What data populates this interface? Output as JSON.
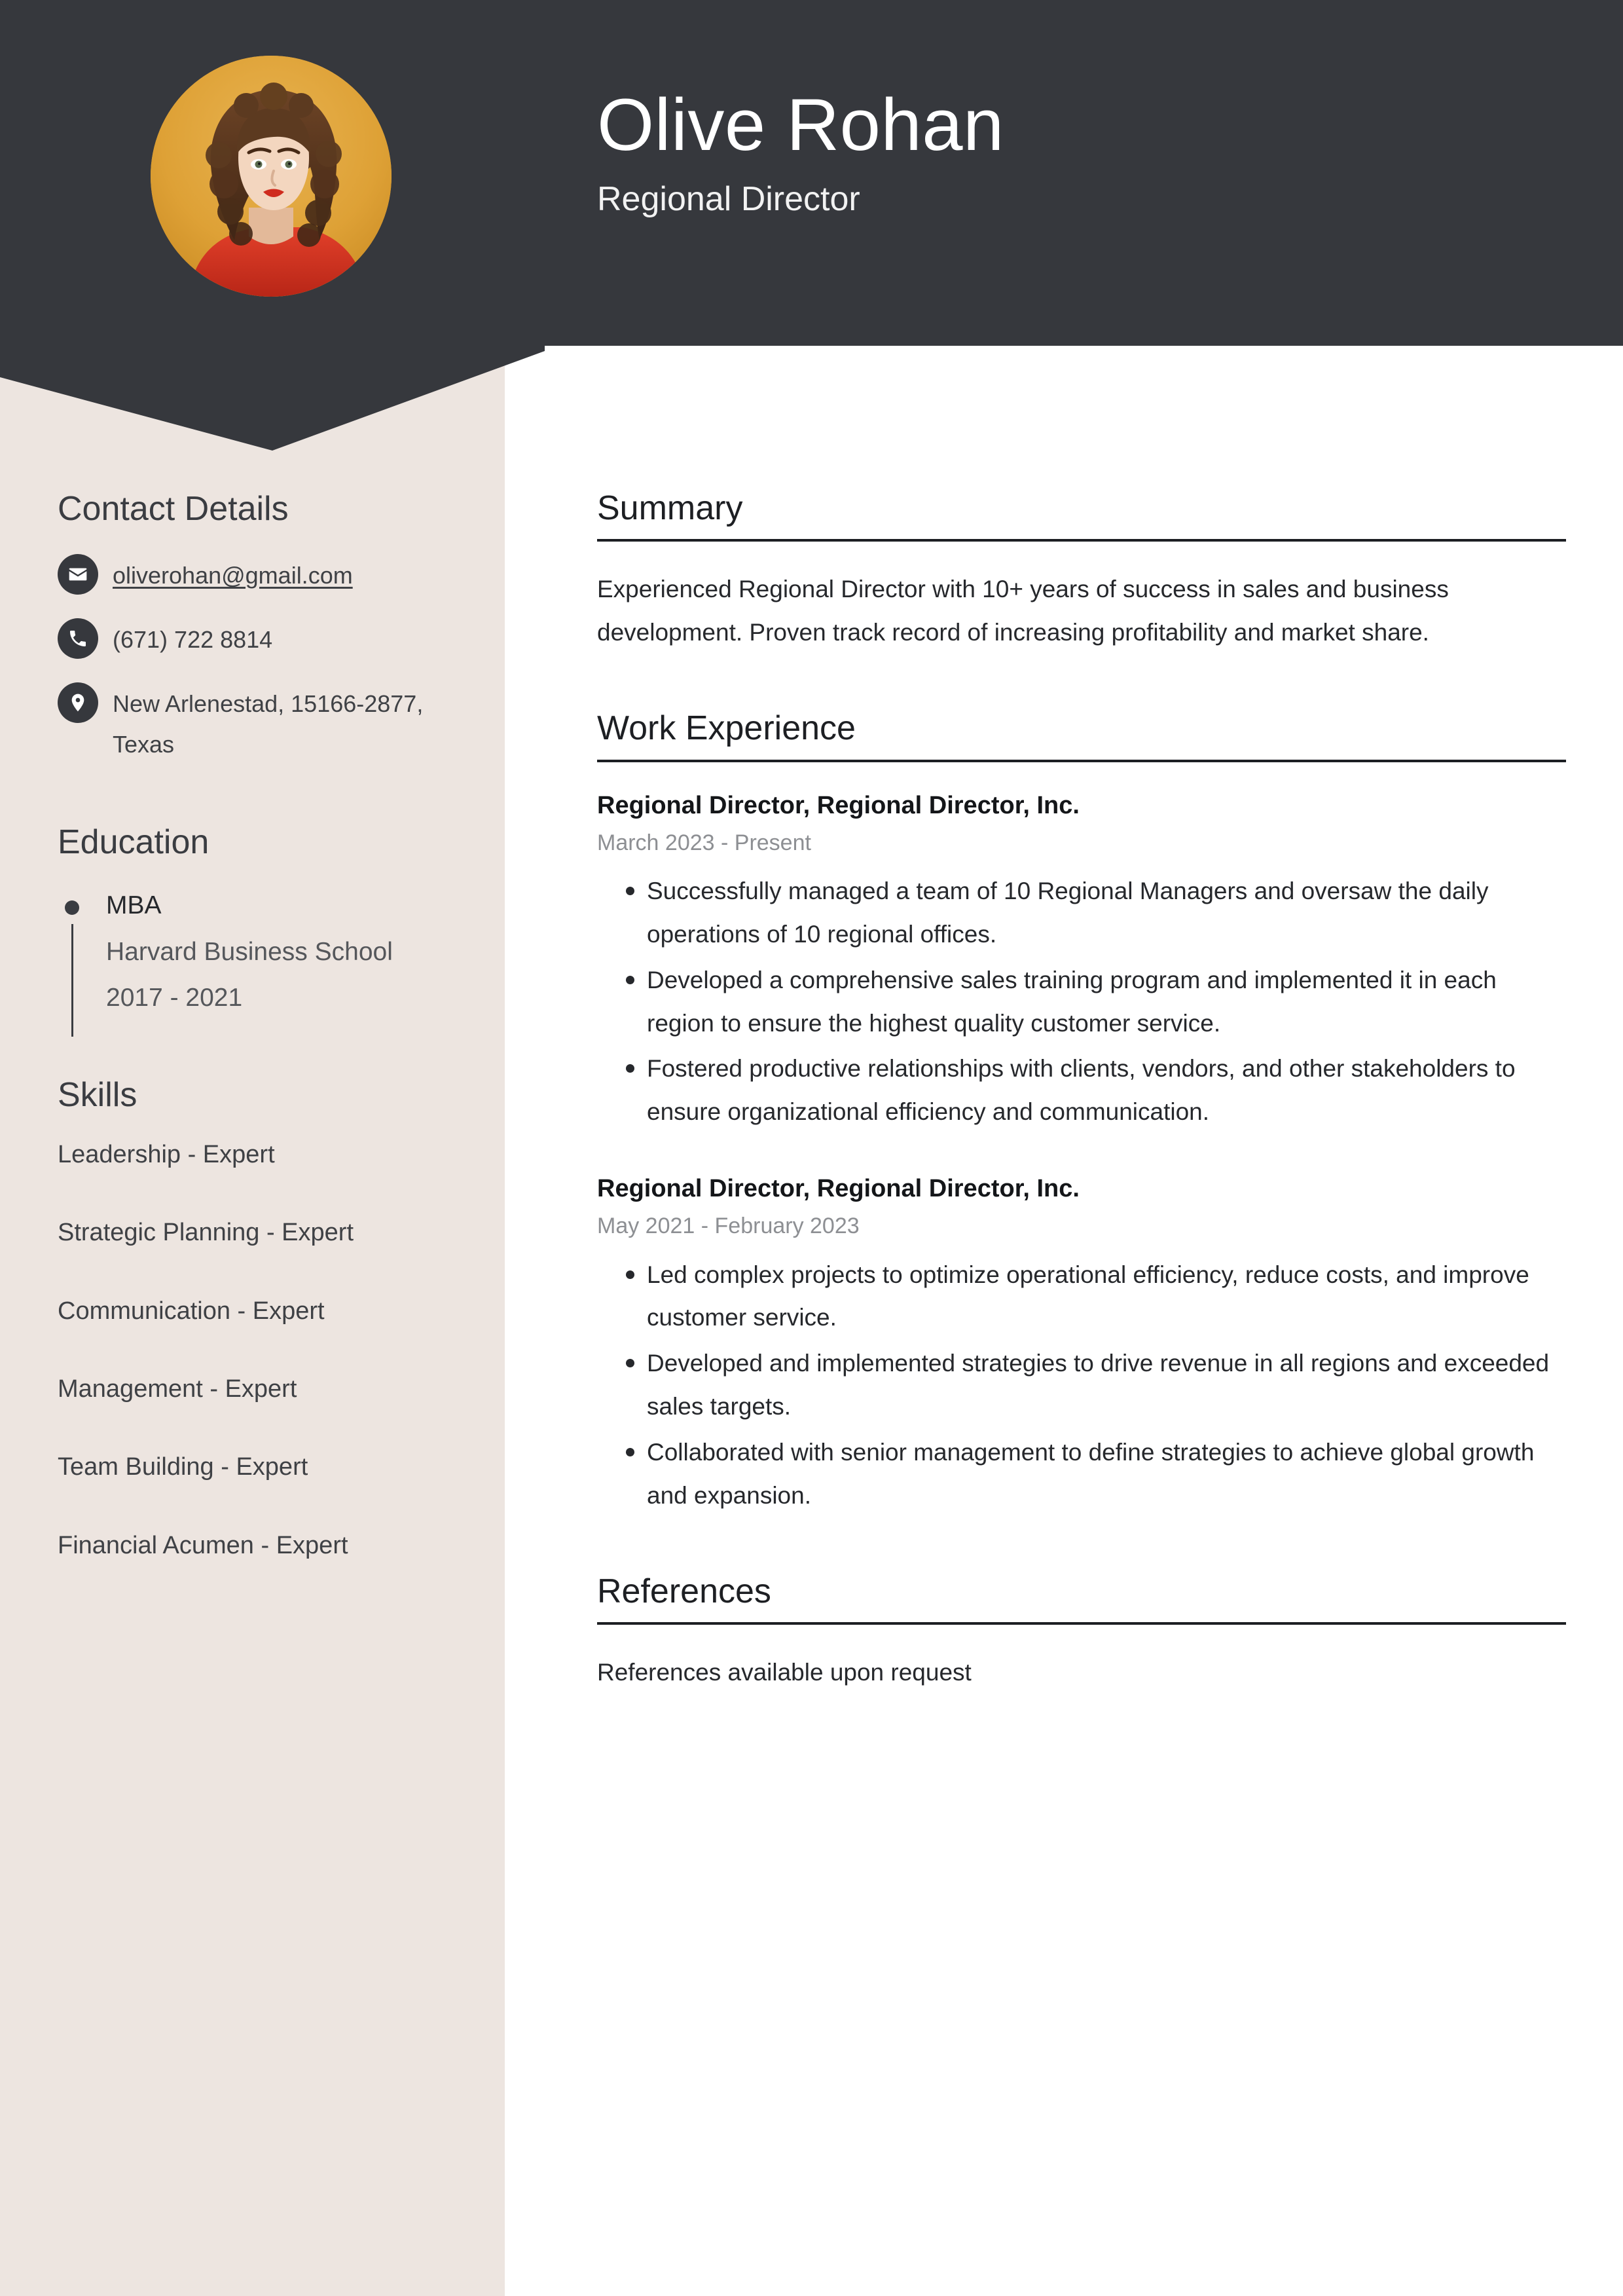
{
  "theme": {
    "header_bg": "#36383d",
    "sidebar_bg": "#ede5e0",
    "page_bg": "#ffffff",
    "accent_photo_bg": "#e0a63a",
    "text_dark": "#26282c",
    "text_muted": "#8d8f93"
  },
  "header": {
    "name": "Olive Rohan",
    "job_title": "Regional Director",
    "avatar_alt": "profile-photo"
  },
  "sidebar": {
    "contact": {
      "heading": "Contact Details",
      "items": [
        {
          "icon": "envelope-icon",
          "value": "oliverohan@gmail.com",
          "is_link": true
        },
        {
          "icon": "phone-icon",
          "value": "(671) 722 8814",
          "is_link": false
        },
        {
          "icon": "location-pin-icon",
          "value": "New Arlenestad, 15166-2877, Texas",
          "is_link": false
        }
      ]
    },
    "education": {
      "heading": "Education",
      "items": [
        {
          "degree": "MBA",
          "school": "Harvard Business School",
          "dates": "2017 - 2021"
        }
      ]
    },
    "skills": {
      "heading": "Skills",
      "items": [
        "Leadership - Expert",
        "Strategic Planning - Expert",
        "Communication - Expert",
        "Management - Expert",
        "Team Building - Expert",
        "Financial Acumen - Expert"
      ]
    }
  },
  "main": {
    "summary": {
      "heading": "Summary",
      "text": "Experienced Regional Director with 10+ years of success in sales and business development. Proven track record of increasing profitability and market share."
    },
    "work_experience": {
      "heading": "Work Experience",
      "jobs": [
        {
          "title": "Regional Director, Regional Director, Inc.",
          "dates": "March 2023 - Present",
          "bullets": [
            "Successfully managed a team of 10 Regional Managers and oversaw the daily operations of 10 regional offices.",
            "Developed a comprehensive sales training program and implemented it in each region to ensure the highest quality customer service.",
            "Fostered productive relationships with clients, vendors, and other stakeholders to ensure organizational efficiency and communication."
          ]
        },
        {
          "title": "Regional Director, Regional Director, Inc.",
          "dates": "May 2021 - February 2023",
          "bullets": [
            "Led complex projects to optimize operational efficiency, reduce costs, and improve customer service.",
            "Developed and implemented strategies to drive revenue in all regions and exceeded sales targets.",
            "Collaborated with senior management to define strategies to achieve global growth and expansion."
          ]
        }
      ]
    },
    "references": {
      "heading": "References",
      "text": "References available upon request"
    }
  }
}
